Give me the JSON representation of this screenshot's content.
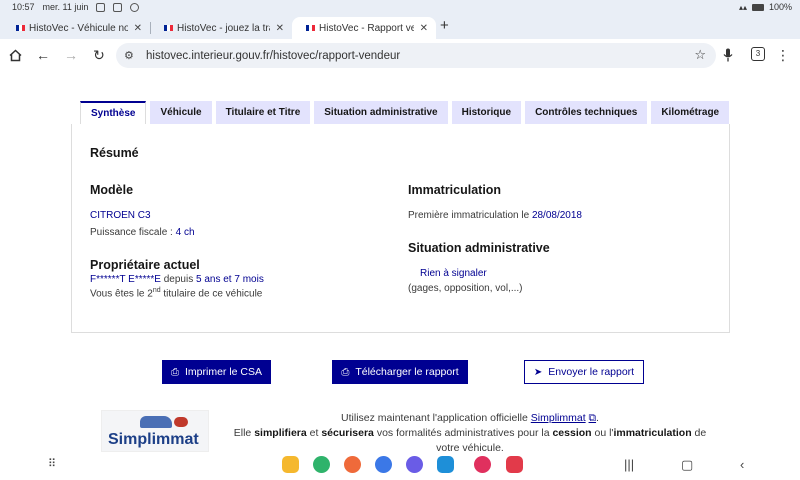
{
  "status_bar": {
    "time": "10:57",
    "date": "mer. 11 juin",
    "battery": "100%"
  },
  "browser": {
    "tabs": [
      {
        "title": "HistoVec - Véhicule non t"
      },
      {
        "title": "HistoVec - jouez la transp"
      },
      {
        "title": "HistoVec - Rapport vende"
      }
    ],
    "url": "histovec.interieur.gouv.fr/histovec/rapport-vendeur",
    "tab_count": "3",
    "icons": [
      "home-icon",
      "back-icon",
      "forward-icon",
      "reload-icon",
      "tune-icon",
      "star-icon",
      "mic-icon",
      "tabs-icon",
      "menu-icon"
    ]
  },
  "page": {
    "tabs": [
      "Synthèse",
      "Véhicule",
      "Titulaire et Titre",
      "Situation administrative",
      "Historique",
      "Contrôles techniques",
      "Kilométrage"
    ],
    "active_tab": "Synthèse",
    "resume_title": "Résumé",
    "modele": {
      "title": "Modèle",
      "name": "CITROEN C3",
      "puissance_label": "Puissance fiscale :",
      "puissance_value": "4 ch"
    },
    "proprietaire": {
      "title": "Propriétaire actuel",
      "name": "F******T E*****E",
      "depuis_label": "depuis",
      "depuis_value": "5 ans et 7 mois",
      "rank_prefix": "Vous êtes le 2",
      "rank_sup": "nd",
      "rank_suffix": "titulaire de ce véhicule"
    },
    "immatriculation": {
      "title": "Immatriculation",
      "label": "Première immatriculation le",
      "date": "28/08/2018"
    },
    "situation": {
      "title": "Situation administrative",
      "status": "Rien à signaler",
      "detail": "(gages, opposition, vol,...)"
    },
    "buttons": {
      "print": "Imprimer le CSA",
      "download": "Télécharger le rapport",
      "send": "Envoyer le rapport"
    },
    "promo": {
      "logo_text": "Simplimmat",
      "line1_prefix": "Utilisez maintenant l'application officielle",
      "app_link": "Simplimmat",
      "line2_a": "Elle",
      "line2_b": "simplifiera",
      "line2_c": "et",
      "line2_d": "sécurisera",
      "line2_e": "vos formalités administratives pour la",
      "line2_f": "cession",
      "line2_g": "ou l'",
      "line2_h": "immatriculation",
      "line2_i": "de",
      "line3": "votre véhicule."
    }
  },
  "colors": {
    "primary": "#000091",
    "tab_bg": "#e3e3fd",
    "flag_blue": "#002395",
    "flag_red": "#ed2939"
  }
}
